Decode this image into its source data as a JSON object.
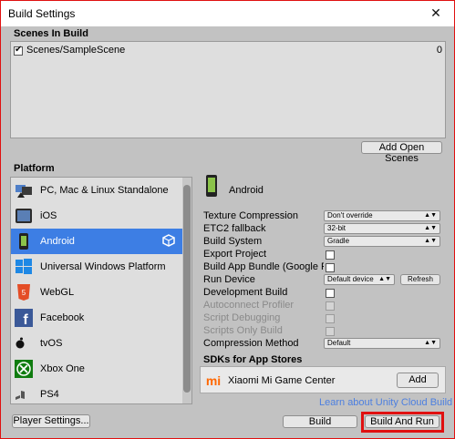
{
  "window": {
    "title": "Build Settings",
    "close_symbol": "✕"
  },
  "scenes": {
    "heading": "Scenes In Build",
    "items": [
      {
        "name": "Scenes/SampleScene",
        "index": "0",
        "checked": true
      }
    ],
    "add_open_scenes": "Add Open Scenes"
  },
  "platform": {
    "heading": "Platform",
    "items": [
      {
        "label": "PC, Mac & Linux Standalone",
        "icon": "standalone-icon"
      },
      {
        "label": "iOS",
        "icon": "ios-icon"
      },
      {
        "label": "Android",
        "icon": "android-icon",
        "selected": true
      },
      {
        "label": "Universal Windows Platform",
        "icon": "windows-icon"
      },
      {
        "label": "WebGL",
        "icon": "html5-icon"
      },
      {
        "label": "Facebook",
        "icon": "facebook-icon"
      },
      {
        "label": "tvOS",
        "icon": "tvos-icon"
      },
      {
        "label": "Xbox One",
        "icon": "xbox-icon"
      },
      {
        "label": "PS4",
        "icon": "ps4-icon"
      }
    ]
  },
  "android": {
    "title": "Android",
    "settings": {
      "texture_compression": {
        "label": "Texture Compression",
        "value": "Don't override"
      },
      "etc2_fallback": {
        "label": "ETC2 fallback",
        "value": "32-bit"
      },
      "build_system": {
        "label": "Build System",
        "value": "Gradle"
      },
      "export_project": {
        "label": "Export Project"
      },
      "build_app_bundle": {
        "label": "Build App Bundle (Google Play)"
      },
      "run_device": {
        "label": "Run Device",
        "value": "Default device",
        "refresh": "Refresh"
      },
      "development_build": {
        "label": "Development Build"
      },
      "autoconnect_profiler": {
        "label": "Autoconnect Profiler"
      },
      "script_debugging": {
        "label": "Script Debugging"
      },
      "scripts_only_build": {
        "label": "Scripts Only Build"
      },
      "compression_method": {
        "label": "Compression Method",
        "value": "Default"
      }
    },
    "sdks_heading": "SDKs for App Stores",
    "sdk": {
      "logo": "mi",
      "name": "Xiaomi Mi Game Center",
      "add": "Add"
    },
    "cloud_link": "Learn about Unity Cloud Build"
  },
  "buttons": {
    "player_settings": "Player Settings...",
    "build": "Build",
    "build_and_run": "Build And Run"
  },
  "colors": {
    "selection": "#3d7ee4",
    "link": "#4c7fe0",
    "highlight": "#e01010"
  }
}
